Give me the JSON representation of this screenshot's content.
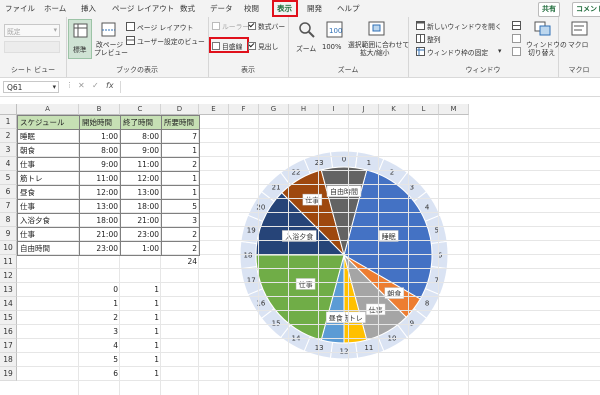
{
  "menu": {
    "items": [
      "ファイル",
      "ホーム",
      "挿入",
      "ページ レイアウト",
      "数式",
      "データ",
      "校閲",
      "表示",
      "開発",
      "ヘルプ"
    ],
    "active": "表示",
    "share": "共有",
    "comment": "コメント"
  },
  "ribbon": {
    "sheet_view": {
      "dropdown": "既定",
      "label": "シート ビュー"
    },
    "workbook_views": {
      "normal": "標準",
      "page_break": "改ページ",
      "page_break2": "プレビュー",
      "page_layout": "ページ レイアウト",
      "custom": "ユーザー設定のビュー",
      "label": "ブックの表示"
    },
    "show": {
      "ruler": "ルーラー",
      "formula_bar": "数式バー",
      "gridlines": "目盛線",
      "headings": "見出し",
      "label": "表示",
      "ruler_checked": false,
      "formula_bar_checked": true,
      "gridlines_checked": false,
      "headings_checked": true
    },
    "zoom": {
      "zoom": "ズーム",
      "hundred": "100%",
      "fit": "選択範囲に合わせて",
      "fit2": "拡大/縮小",
      "label": "ズーム"
    },
    "window": {
      "new_window": "新しいウィンドウを開く",
      "arrange": "整列",
      "freeze": "ウィンドウ枠の固定",
      "switch": "ウィンドウの",
      "switch2": "切り替え",
      "label": "ウィンドウ"
    },
    "macro": {
      "macro": "マクロ",
      "label": "マクロ"
    }
  },
  "formula_bar": {
    "name_box": "Q61",
    "fx": "fx",
    "value": ""
  },
  "columns": [
    "A",
    "B",
    "C",
    "D",
    "E",
    "F",
    "G",
    "H",
    "I",
    "J",
    "K",
    "L",
    "M"
  ],
  "rows": [
    "1",
    "2",
    "3",
    "4",
    "5",
    "6",
    "7",
    "8",
    "9",
    "10",
    "11",
    "12",
    "13",
    "14",
    "15",
    "16",
    "17",
    "18",
    "19"
  ],
  "table": {
    "headers": [
      "スケジュール",
      "開始時間",
      "終了時間",
      "所要時間"
    ],
    "rows": [
      [
        "睡眠",
        "1:00",
        "8:00",
        "7"
      ],
      [
        "朝食",
        "8:00",
        "9:00",
        "1"
      ],
      [
        "仕事",
        "9:00",
        "11:00",
        "2"
      ],
      [
        "筋トレ",
        "11:00",
        "12:00",
        "1"
      ],
      [
        "昼食",
        "12:00",
        "13:00",
        "1"
      ],
      [
        "仕事",
        "13:00",
        "18:00",
        "5"
      ],
      [
        "入浴夕食",
        "18:00",
        "21:00",
        "3"
      ],
      [
        "仕事",
        "21:00",
        "23:00",
        "2"
      ],
      [
        "自由時間",
        "23:00",
        "1:00",
        "2"
      ]
    ],
    "total": "24"
  },
  "hours_list": [
    {
      "b": "0",
      "c": "1"
    },
    {
      "b": "1",
      "c": "1"
    },
    {
      "b": "2",
      "c": "1"
    },
    {
      "b": "3",
      "c": "1"
    },
    {
      "b": "4",
      "c": "1"
    },
    {
      "b": "5",
      "c": "1"
    },
    {
      "b": "6",
      "c": "1"
    }
  ],
  "chart_data": {
    "type": "pie",
    "start_hour": 1,
    "slices": [
      {
        "label": "睡眠",
        "value": 7,
        "color": "#4472c4"
      },
      {
        "label": "朝食",
        "value": 1,
        "color": "#ed7d31"
      },
      {
        "label": "仕事",
        "value": 2,
        "color": "#a5a5a5"
      },
      {
        "label": "筋トレ",
        "value": 1,
        "color": "#ffc000"
      },
      {
        "label": "昼食",
        "value": 1,
        "color": "#5b9bd5"
      },
      {
        "label": "仕事",
        "value": 5,
        "color": "#70ad47"
      },
      {
        "label": "入浴夕食",
        "value": 3,
        "color": "#264478"
      },
      {
        "label": "仕事",
        "value": 2,
        "color": "#9e480e"
      },
      {
        "label": "自由時間",
        "value": 2,
        "color": "#636363"
      }
    ],
    "hour_ring": [
      "0",
      "1",
      "2",
      "3",
      "4",
      "5",
      "6",
      "7",
      "8",
      "9",
      "10",
      "11",
      "12",
      "13",
      "14",
      "15",
      "16",
      "17",
      "18",
      "19",
      "20",
      "21",
      "22",
      "23"
    ],
    "ring_color": "#dae3f3"
  }
}
